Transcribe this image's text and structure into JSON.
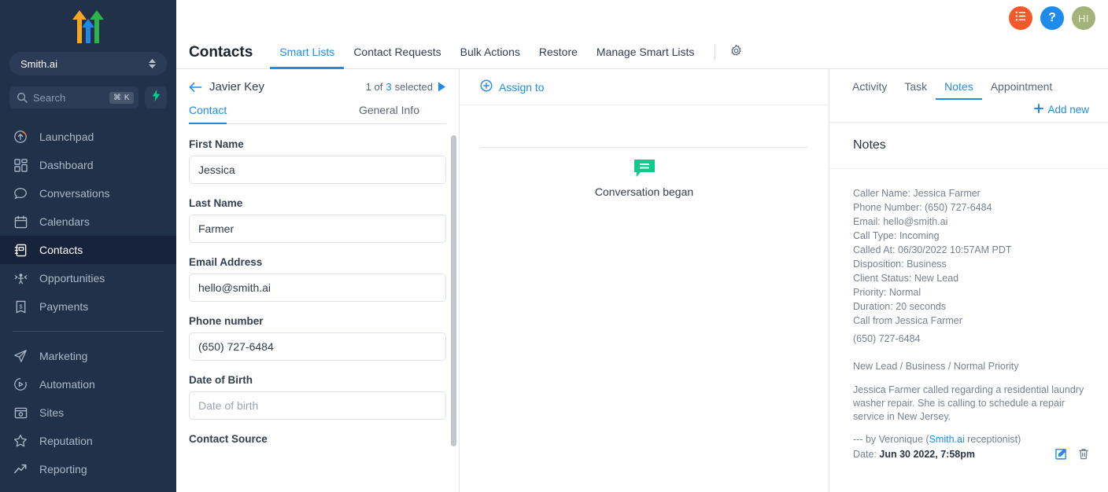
{
  "sidebar": {
    "logo_icon": "three-arrows-logo",
    "location": {
      "name": "Smith.ai",
      "icon": "up-down-chevrons-icon"
    },
    "search": {
      "placeholder": "Search",
      "shortcut": "⌘ K",
      "icon": "search-icon",
      "bolt_icon": "bolt-icon"
    },
    "items": [
      {
        "label": "Launchpad",
        "icon": "launchpad-icon",
        "active": false
      },
      {
        "label": "Dashboard",
        "icon": "dashboard-grid-icon",
        "active": false
      },
      {
        "label": "Conversations",
        "icon": "chat-bubble-icon",
        "active": false
      },
      {
        "label": "Calendars",
        "icon": "calendar-icon",
        "active": false
      },
      {
        "label": "Contacts",
        "icon": "contacts-book-icon",
        "active": true
      },
      {
        "label": "Opportunities",
        "icon": "opportunities-icon",
        "active": false
      },
      {
        "label": "Payments",
        "icon": "payments-receipt-icon",
        "active": false
      }
    ],
    "items2": [
      {
        "label": "Marketing",
        "icon": "paper-plane-icon",
        "active": false
      },
      {
        "label": "Automation",
        "icon": "play-circle-icon",
        "active": false
      },
      {
        "label": "Sites",
        "icon": "sites-window-icon",
        "active": false
      },
      {
        "label": "Reputation",
        "icon": "star-icon",
        "active": false
      },
      {
        "label": "Reporting",
        "icon": "trend-up-icon",
        "active": false
      }
    ]
  },
  "topbar": {
    "list_button_icon": "list-icon",
    "help_button_label": "?",
    "avatar_initials": "HI"
  },
  "header": {
    "title": "Contacts",
    "tabs": [
      {
        "label": "Smart Lists",
        "active": true
      },
      {
        "label": "Contact Requests",
        "active": false
      },
      {
        "label": "Bulk Actions",
        "active": false
      },
      {
        "label": "Restore",
        "active": false
      },
      {
        "label": "Manage Smart Lists",
        "active": false
      }
    ],
    "settings_icon": "gear-icon"
  },
  "contact_panel": {
    "back_icon": "arrow-left-icon",
    "contact_name": "Javier Key",
    "selection_prefix": "1 of",
    "selection_count": "3",
    "selection_suffix": "selected",
    "next_icon": "arrow-right-icon",
    "tabs": [
      {
        "label": "Contact",
        "active": true
      },
      {
        "label": "General Info",
        "active": false
      }
    ],
    "fields": [
      {
        "label": "First Name",
        "value": "Jessica",
        "placeholder": ""
      },
      {
        "label": "Last Name",
        "value": "Farmer",
        "placeholder": ""
      },
      {
        "label": "Email Address",
        "value": "hello@smith.ai",
        "placeholder": ""
      },
      {
        "label": "Phone number",
        "value": "(650) 727-6484",
        "placeholder": ""
      },
      {
        "label": "Date of Birth",
        "value": "",
        "placeholder": "Date of birth"
      }
    ],
    "next_label": "Contact Source"
  },
  "conversation": {
    "assign_label": "Assign to",
    "assign_icon": "plus-circle-icon",
    "began_label": "Conversation began",
    "began_icon": "message-bubble-icon"
  },
  "notes_panel": {
    "tabs": [
      {
        "label": "Activity",
        "active": false
      },
      {
        "label": "Task",
        "active": false
      },
      {
        "label": "Notes",
        "active": true
      },
      {
        "label": "Appointment",
        "active": false
      }
    ],
    "add_new_label": "Add new",
    "add_new_icon": "plus-icon",
    "section_title": "Notes",
    "note": {
      "lines": [
        "Caller Name: Jessica Farmer",
        "Phone Number: (650) 727-6484",
        "Email: hello@smith.ai",
        "Call Type: Incoming",
        "Called At: 06/30/2022 10:57AM PDT",
        "Disposition: Business",
        "Client Status: New Lead",
        "Priority: Normal",
        "Duration: 20 seconds",
        "Call from Jessica Farmer"
      ],
      "phone": "(650) 727-6484",
      "tags": "New Lead / Business / Normal Priority",
      "body": "Jessica Farmer called regarding a residential laundry washer repair. She is calling to schedule a repair service in New Jersey.",
      "by_prefix": "--- by Veronique (",
      "by_brand": "Smith.ai",
      "by_suffix": " receptionist)",
      "date_label": "Date:",
      "date_value": "Jun 30 2022, 7:58pm",
      "edit_icon": "edit-square-icon",
      "delete_icon": "trash-icon"
    }
  },
  "colors": {
    "sidebar_bg": "#21314a",
    "accent_blue": "#1f8ceb",
    "orange": "#f4592b",
    "green": "#00c37f",
    "avatar_olive": "#a3b379"
  }
}
